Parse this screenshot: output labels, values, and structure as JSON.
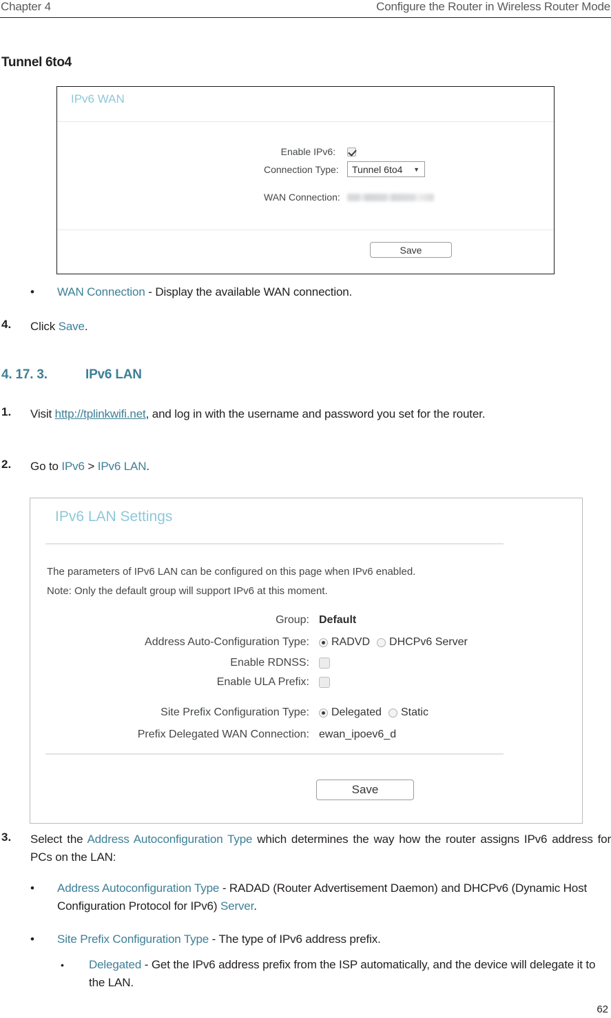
{
  "header": {
    "left": "Chapter 4",
    "right": "Configure the Router in Wireless Router Mode"
  },
  "section_heading": "Tunnel 6to4",
  "ipv6_wan_panel": {
    "title": "IPv6 WAN",
    "rows": {
      "enable_ipv6_label": "Enable IPv6:",
      "enable_ipv6_checked": true,
      "connection_type_label": "Connection Type:",
      "connection_type_value": "Tunnel 6to4",
      "connection_type_options": [
        "Tunnel 6to4"
      ],
      "wan_connection_label": "WAN Connection:",
      "wan_connection_value": ""
    },
    "save_label": "Save"
  },
  "bullet_wan_connection": {
    "marker": "•",
    "link": "WAN Connection",
    "rest": " - Display the available WAN connection."
  },
  "step_4": {
    "number": "4.",
    "pre": "Click ",
    "link": "Save",
    "post": "."
  },
  "subsection": {
    "number": "4. 17. 3.",
    "title": "IPv6 LAN"
  },
  "step_1": {
    "number": "1.",
    "pre": "Visit ",
    "link": "http://tplinkwifi.net",
    "post": ", and log in with the username and password you set for the router."
  },
  "step_2": {
    "number": "2.",
    "pre": "Go to ",
    "link1": "IPv6",
    "mid": " > ",
    "link2": "IPv6 LAN",
    "post": "."
  },
  "ipv6_lan_panel": {
    "title": "IPv6 LAN Settings",
    "note_line_1": "The parameters of IPv6 LAN can be configured on this page when IPv6 enabled.",
    "note_line_2": "Note: Only the default group will support IPv6 at this moment.",
    "rows": {
      "group_label": "Group:",
      "group_value": "Default",
      "address_auto_config_label": "Address Auto-Configuration Type:",
      "address_auto_config_option_1": "RADVD",
      "address_auto_config_option_2": "DHCPv6 Server",
      "address_auto_config_selected": "RADVD",
      "enable_rdnss_label": "Enable RDNSS:",
      "enable_rdnss_checked": false,
      "enable_ula_prefix_label": "Enable ULA Prefix:",
      "enable_ula_prefix_checked": false,
      "site_prefix_label": "Site Prefix Configuration Type:",
      "site_prefix_option_1": "Delegated",
      "site_prefix_option_2": "Static",
      "site_prefix_selected": "Delegated",
      "prefix_delegated_wan_label": "Prefix Delegated WAN Connection:",
      "prefix_delegated_wan_value": "ewan_ipoev6_d"
    },
    "save_label": "Save"
  },
  "step_3": {
    "number": "3.",
    "pre": "Select the ",
    "link": "Address Autoconfiguration Type",
    "post": " which determines the way how the router assigns IPv6 address for PCs on the LAN:"
  },
  "bullets": [
    {
      "marker": "•",
      "link": "Address Autoconfiguration Type",
      "mid": " - RADAD (Router Advertisement Daemon) and DHCPv6 (Dynamic Host Configuration Protocol for IPv6) ",
      "link2": "Server",
      "post": "."
    },
    {
      "marker": "•",
      "link": "Site Prefix Configuration Type",
      "mid": " - The type of IPv6 address prefix.",
      "link2": "",
      "post": ""
    }
  ],
  "sub_bullet": {
    "marker": "•",
    "link": "Delegated",
    "rest": " - Get the IPv6 address prefix from the ISP automatically, and the device will delegate it to the LAN."
  },
  "page_number": "62",
  "colors": {
    "link": "#3d7f96",
    "panel_title": "#8ec8d9",
    "header_text": "#58595b",
    "body_text": "#231f20"
  }
}
